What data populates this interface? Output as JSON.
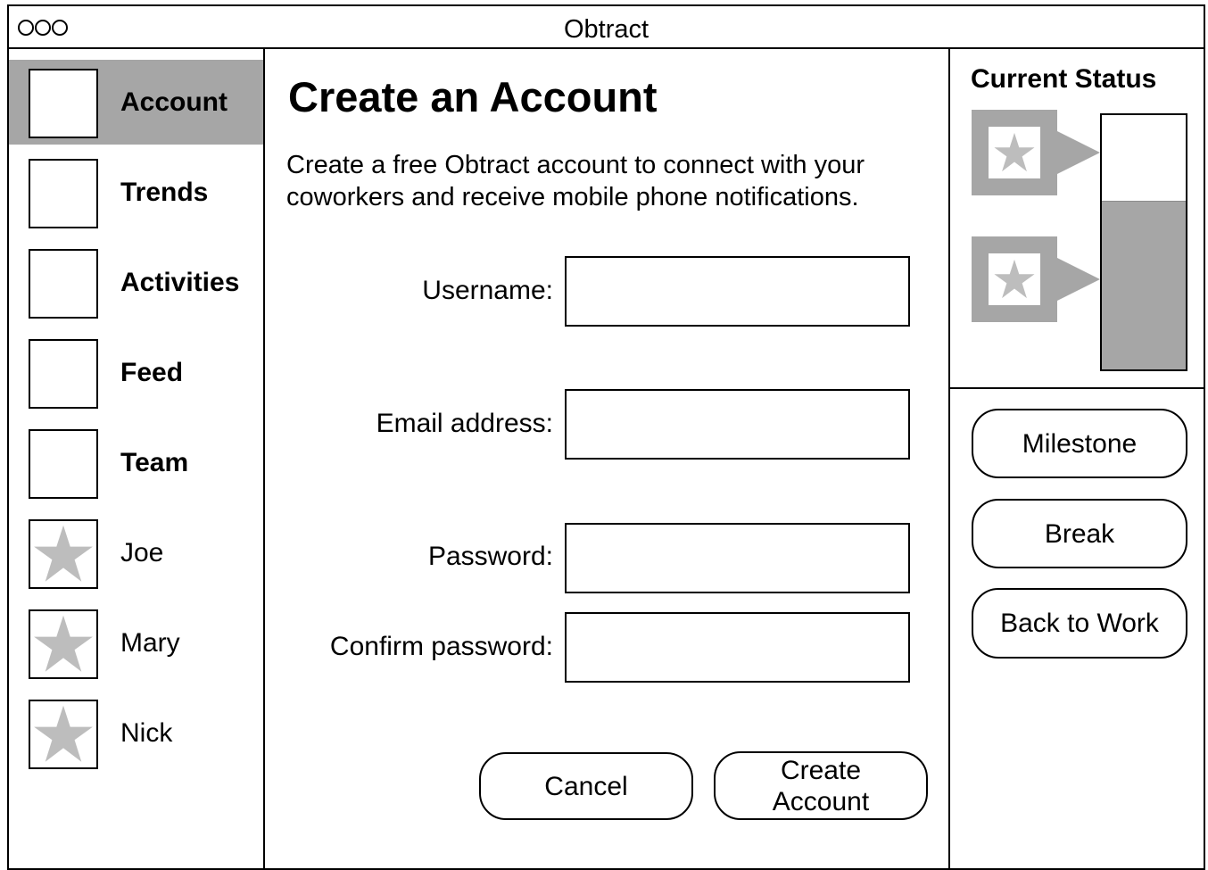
{
  "window": {
    "title": "Obtract"
  },
  "sidebar": {
    "items": [
      {
        "label": "Account",
        "icon": "account-icon",
        "active": true,
        "bold": true
      },
      {
        "label": "Trends",
        "icon": "trends-icon",
        "active": false,
        "bold": true
      },
      {
        "label": "Activities",
        "icon": "activities-icon",
        "active": false,
        "bold": true
      },
      {
        "label": "Feed",
        "icon": "feed-icon",
        "active": false,
        "bold": true
      },
      {
        "label": "Team",
        "icon": "team-icon",
        "active": false,
        "bold": true
      },
      {
        "label": "Joe",
        "icon": "star-icon",
        "active": false,
        "bold": false
      },
      {
        "label": "Mary",
        "icon": "star-icon",
        "active": false,
        "bold": false
      },
      {
        "label": "Nick",
        "icon": "star-icon",
        "active": false,
        "bold": false
      }
    ]
  },
  "main": {
    "heading": "Create an Account",
    "description": "Create a free Obtract account to connect with your coworkers and receive mobile phone notifications.",
    "fields": {
      "username": {
        "label": "Username:",
        "value": ""
      },
      "email": {
        "label": "Email address:",
        "value": ""
      },
      "password": {
        "label": "Password:",
        "value": ""
      },
      "confirm_password": {
        "label": "Confirm password:",
        "value": ""
      }
    },
    "buttons": {
      "cancel": "Cancel",
      "create_line1": "Create",
      "create_line2": "Account"
    }
  },
  "status": {
    "title": "Current Status",
    "markers": [
      {
        "icon": "star-icon"
      },
      {
        "icon": "star-icon"
      }
    ],
    "level_fraction": 0.66
  },
  "actions": {
    "milestone": "Milestone",
    "break": "Break",
    "back_to_work": "Back to Work"
  },
  "colors": {
    "highlight_gray": "#a6a6a6",
    "star_gray": "#bdbdbd",
    "border": "#000000",
    "background": "#ffffff"
  }
}
